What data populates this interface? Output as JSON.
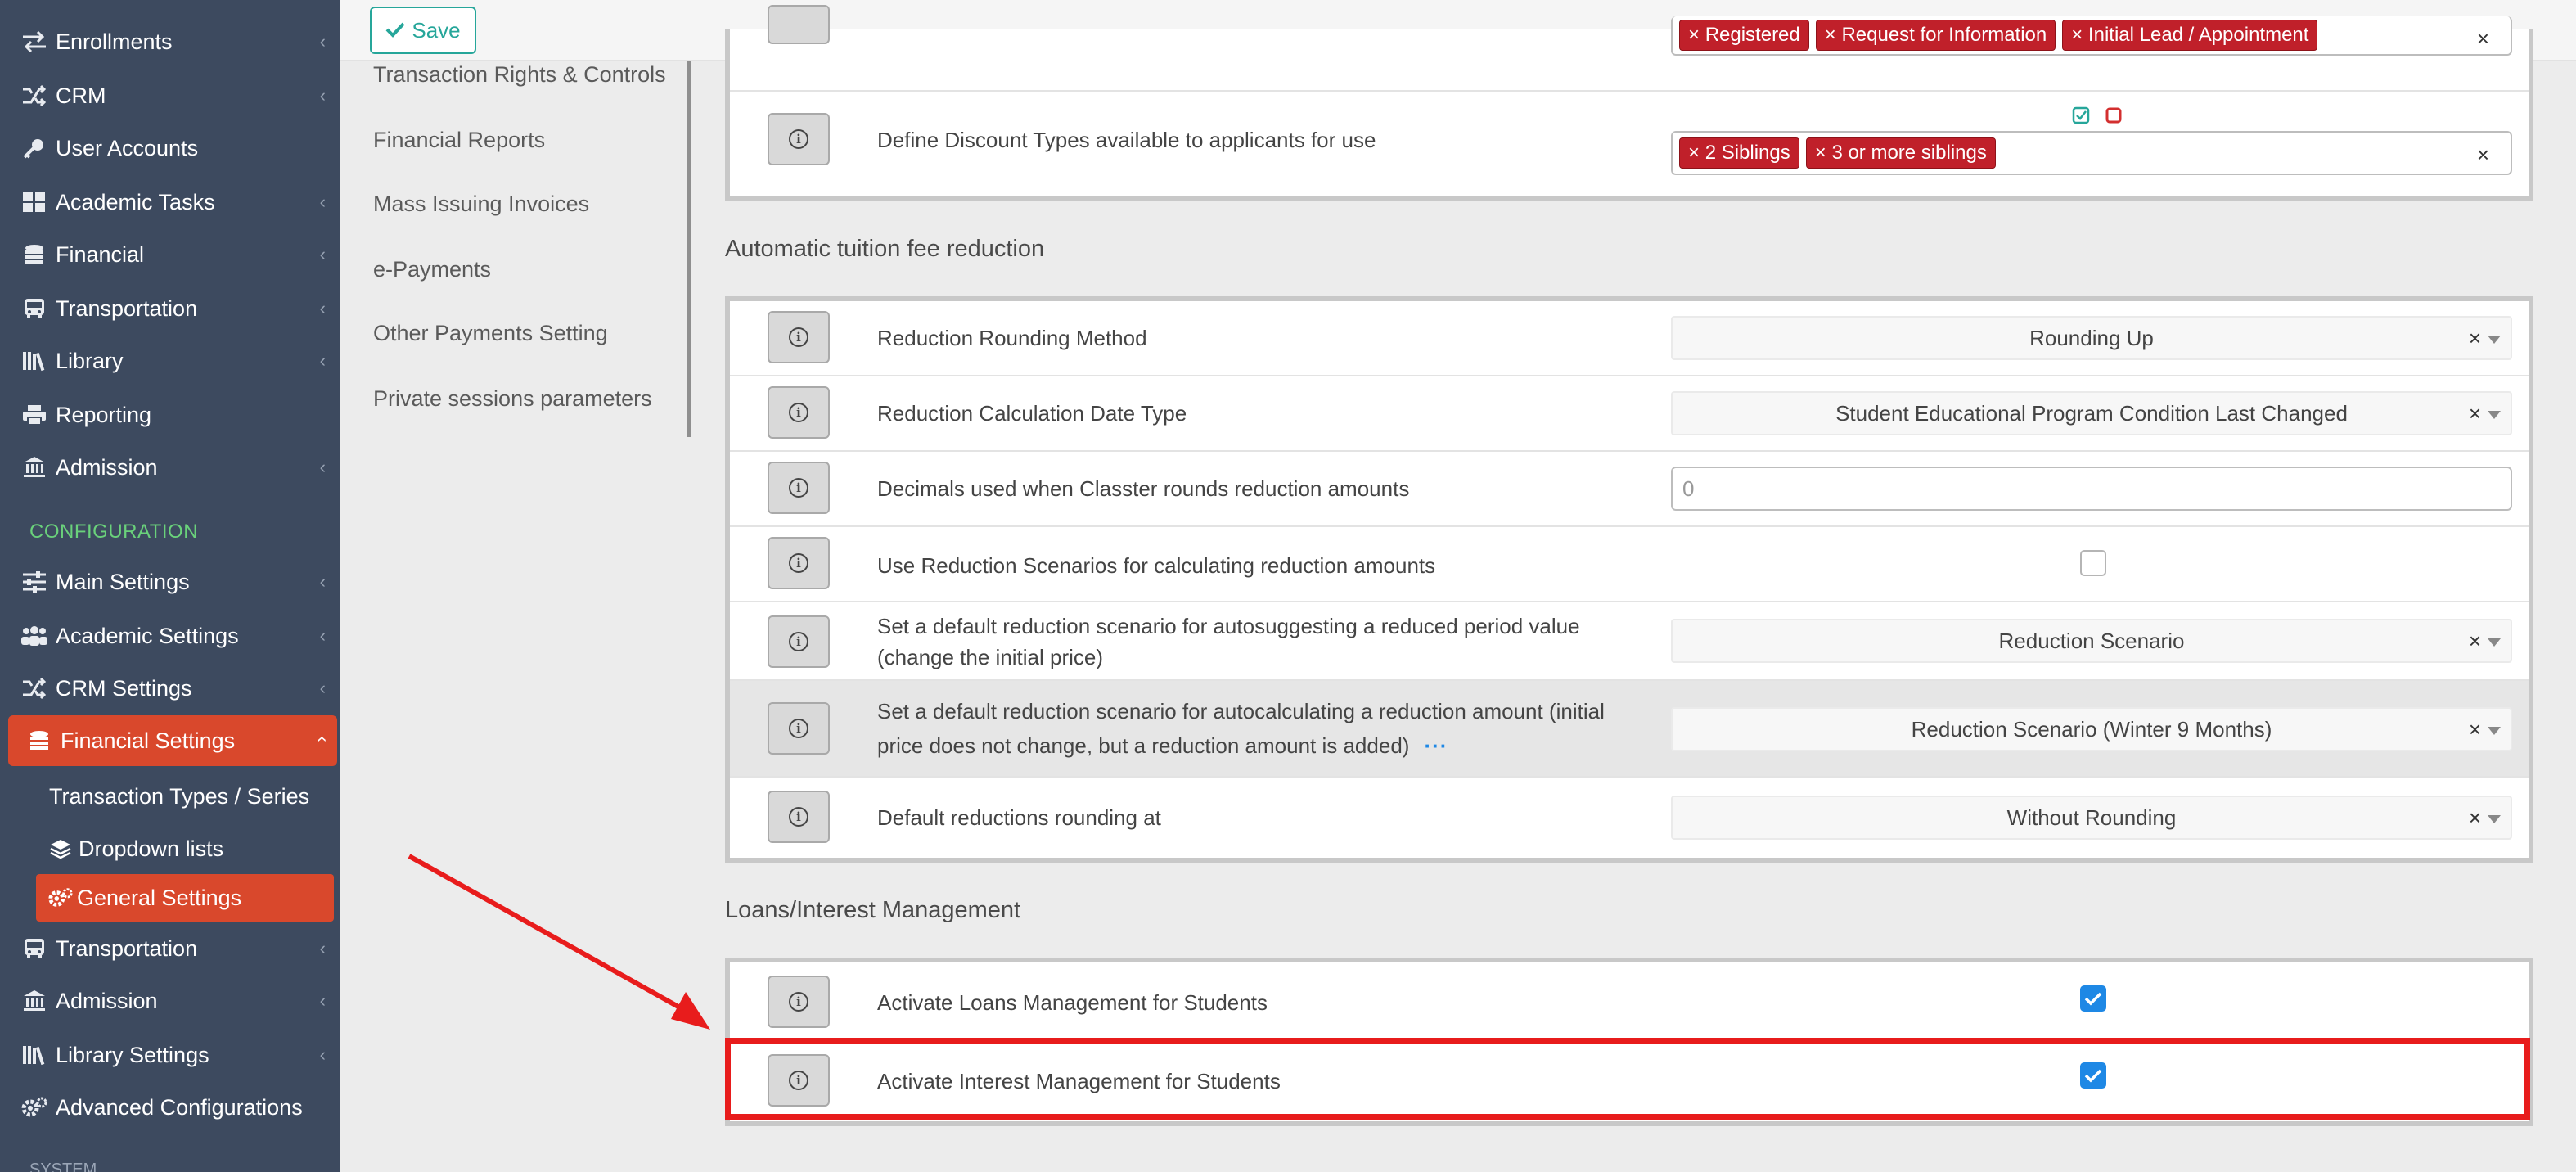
{
  "sidebar": {
    "items": [
      {
        "label": "Enrollments",
        "icon": "arrows-exchange-icon"
      },
      {
        "label": "CRM",
        "icon": "shuffle-icon"
      },
      {
        "label": "User Accounts",
        "icon": "key-icon"
      },
      {
        "label": "Academic Tasks",
        "icon": "grid-icon"
      },
      {
        "label": "Financial",
        "icon": "coins-icon"
      },
      {
        "label": "Transportation",
        "icon": "bus-icon"
      },
      {
        "label": "Library",
        "icon": "books-icon"
      },
      {
        "label": "Reporting",
        "icon": "printer-icon"
      },
      {
        "label": "Admission",
        "icon": "bank-icon"
      }
    ],
    "config_heading": "CONFIGURATION",
    "config_items": [
      {
        "label": "Main Settings",
        "icon": "sliders-icon"
      },
      {
        "label": "Academic Settings",
        "icon": "users-icon"
      },
      {
        "label": "CRM Settings",
        "icon": "shuffle-icon"
      },
      {
        "label": "Financial Settings",
        "icon": "coins-icon"
      }
    ],
    "financial_sub": [
      {
        "label": "Transaction Types / Series"
      },
      {
        "label": "Dropdown lists",
        "icon": "layers-icon"
      },
      {
        "label": "General Settings",
        "icon": "gears-icon"
      }
    ],
    "config_items_after": [
      {
        "label": "Transportation",
        "icon": "bus-icon"
      },
      {
        "label": "Admission",
        "icon": "bank-icon"
      },
      {
        "label": "Library Settings",
        "icon": "books-icon"
      },
      {
        "label": "Advanced Configurations",
        "icon": "gears-icon"
      }
    ],
    "bottom_heading": "SYSTEM"
  },
  "toolbar": {
    "save_label": "Save"
  },
  "subnav": [
    "Transaction Rights & Controls",
    "Financial Reports",
    "Mass Issuing Invoices",
    "e-Payments",
    "Other Payments Setting",
    "Private sessions parameters"
  ],
  "top_panel": {
    "partial_tags": [
      "Registered",
      "Request for Information",
      "Initial Lead / Appointment"
    ],
    "discount_label": "Define Discount Types available to applicants for use",
    "discount_tags": [
      "2 Siblings",
      "3 or more siblings"
    ]
  },
  "reduction": {
    "title": "Automatic tuition fee reduction",
    "rows": [
      {
        "label": "Reduction Rounding Method",
        "value": "Rounding Up"
      },
      {
        "label": "Reduction Calculation Date Type",
        "value": "Student Educational Program Condition Last Changed"
      },
      {
        "label": "Decimals used when Classter rounds reduction amounts",
        "value": "0"
      },
      {
        "label": "Use Reduction Scenarios for calculating reduction amounts",
        "checked": false
      },
      {
        "label": "Set a default reduction scenario for autosuggesting a reduced period value (change the initial price)",
        "value": "Reduction Scenario"
      },
      {
        "label": "Set a default reduction scenario for autocalculating a reduction amount (initial price does not change, but a reduction amount is added)",
        "value": "Reduction Scenario (Winter 9 Months)",
        "more": "···"
      },
      {
        "label": "Default reductions rounding at",
        "value": "Without Rounding"
      }
    ]
  },
  "loans": {
    "title": "Loans/Interest Management",
    "rows": [
      {
        "label": "Activate Loans Management for Students",
        "checked": true
      },
      {
        "label": "Activate Interest Management for Students",
        "checked": true
      }
    ]
  },
  "colors": {
    "sidebar_bg": "#3d4a5f",
    "accent": "#d9482c",
    "config_heading": "#6ad17b",
    "tag": "#c0202a",
    "checkbox": "#1e88e5",
    "annotation": "#e81c1c"
  }
}
